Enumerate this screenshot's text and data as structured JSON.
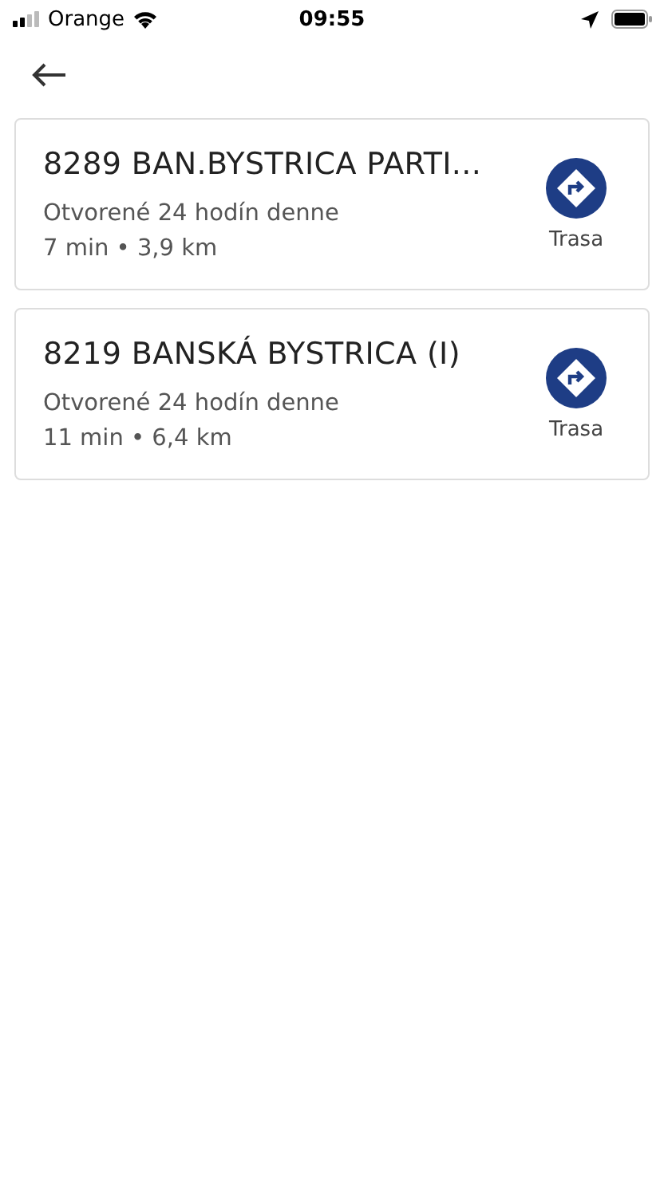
{
  "status_bar": {
    "carrier": "Orange",
    "time": "09:55"
  },
  "results": [
    {
      "title": "8289 BAN.BYSTRICA PARTI...",
      "hours": "Otvorené 24 hodín denne",
      "distance": "7 min • 3,9 km",
      "action": "Trasa"
    },
    {
      "title": "8219 BANSKÁ BYSTRICA (I)",
      "hours": "Otvorené 24 hodín denne",
      "distance": "11 min • 6,4 km",
      "action": "Trasa"
    }
  ]
}
